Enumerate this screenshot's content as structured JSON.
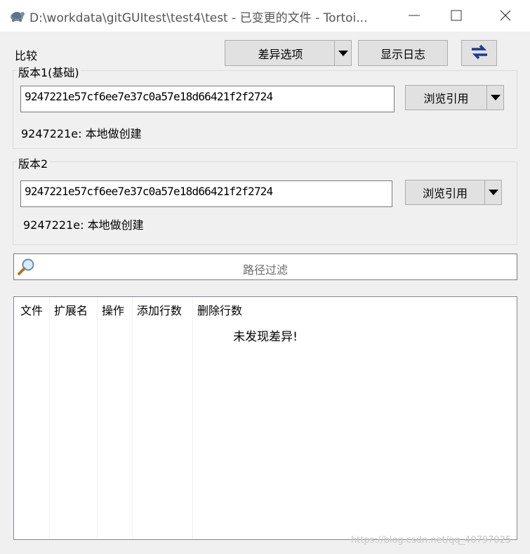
{
  "window": {
    "title": "D:\\workdata\\gitGUItest\\test4\\test - 已变更的文件 - Tortoi..."
  },
  "compare": {
    "label": "比较",
    "diff_options_label": "差异选项",
    "show_log_label": "显示日志"
  },
  "version1": {
    "title": "版本1(基础)",
    "hash": "9247221e57cf6ee7e37c0a57e18d66421f2f2724",
    "short_hash": "9247221e:",
    "message": "本地做创建",
    "browse_label": "浏览引用"
  },
  "version2": {
    "title": "版本2",
    "hash": "9247221e57cf6ee7e37c0a57e18d66421f2f2724",
    "short_hash": "9247221e:",
    "message": "本地做创建",
    "browse_label": "浏览引用"
  },
  "filter": {
    "placeholder": "路径过滤"
  },
  "file_list": {
    "columns": [
      "文件",
      "扩展名",
      "操作",
      "添加行数",
      "删除行数"
    ],
    "empty_message": "未发现差异!"
  },
  "watermark": "https://blog.csdn.net/qq_40797025",
  "colors": {
    "swap_icon": "#1f3a93",
    "background": "#f0f0f0",
    "button": "#e1e1e1"
  }
}
